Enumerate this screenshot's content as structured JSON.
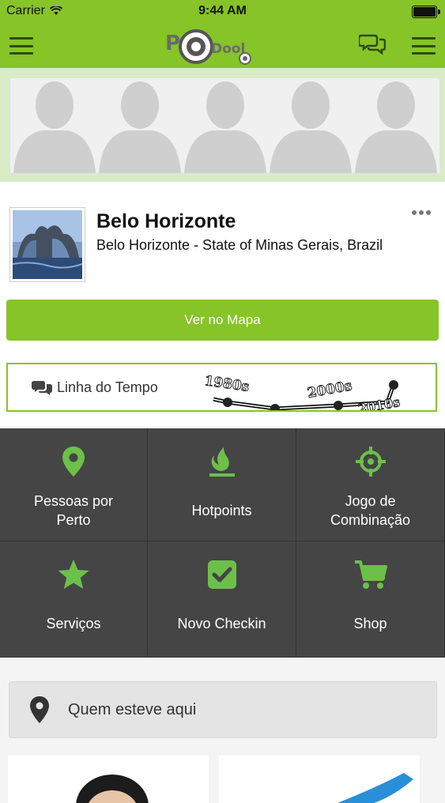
{
  "status_bar": {
    "carrier": "Carrier",
    "time": "9:44 AM"
  },
  "nav": {
    "logo_left": "P",
    "logo_right": "Dool"
  },
  "profile": {
    "name": "Belo Horizonte",
    "location": "Belo Horizonte - State of Minas Gerais, Brazil",
    "map_button": "Ver no Mapa"
  },
  "timeline": {
    "label": "Linha do Tempo",
    "years": [
      "1980s",
      "2000s",
      "2010s"
    ]
  },
  "menu": [
    {
      "label": "Pessoas por",
      "label2": "Perto",
      "icon": "location-pin-icon"
    },
    {
      "label": "Hotpoints",
      "label2": "",
      "icon": "flame-icon"
    },
    {
      "label": "Jogo de",
      "label2": "Combinação",
      "icon": "crosshair-icon"
    },
    {
      "label": "Serviços",
      "label2": "",
      "icon": "star-icon"
    },
    {
      "label": "Novo Checkin",
      "label2": "",
      "icon": "checkbox-icon"
    },
    {
      "label": "Shop",
      "label2": "",
      "icon": "cart-icon"
    }
  ],
  "visited": {
    "label": "Quem esteve aqui"
  },
  "colors": {
    "brand_green": "#86c428",
    "grid_bg": "#454545",
    "icon_green": "#6cc04a"
  }
}
